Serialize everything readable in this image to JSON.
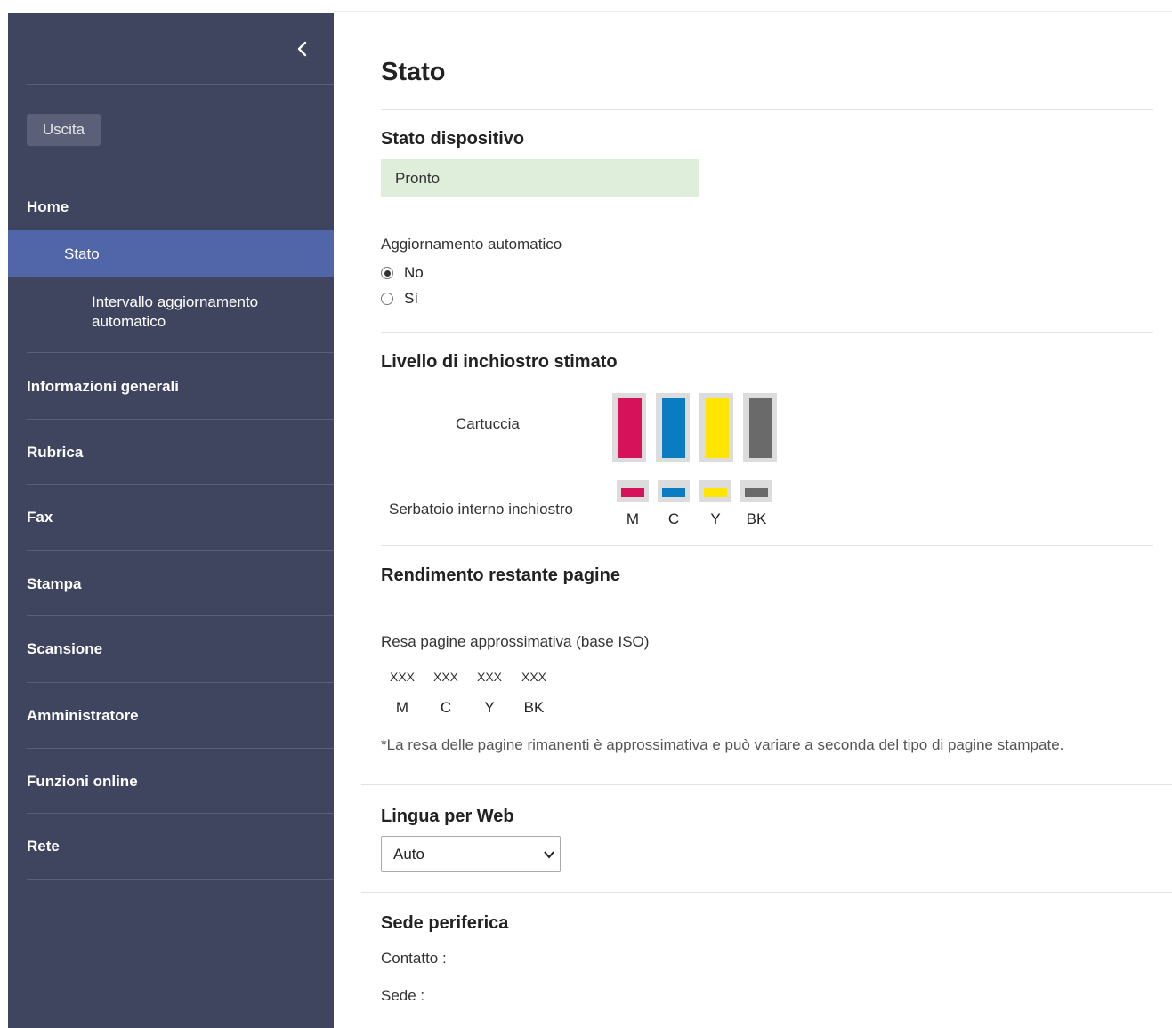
{
  "sidebar": {
    "logout_label": "Uscita",
    "home_label": "Home",
    "status_label": "Stato",
    "auto_refresh_interval_label": "Intervallo aggiornamento automatico",
    "items": [
      {
        "label": "Informazioni generali"
      },
      {
        "label": "Rubrica"
      },
      {
        "label": "Fax"
      },
      {
        "label": "Stampa"
      },
      {
        "label": "Scansione"
      },
      {
        "label": "Amministratore"
      },
      {
        "label": "Funzioni online"
      },
      {
        "label": "Rete"
      }
    ]
  },
  "main": {
    "title": "Stato",
    "device_status": {
      "heading": "Stato dispositivo",
      "value": "Pronto",
      "status_color": "#dfeeda"
    },
    "auto_refresh": {
      "label": "Aggiornamento automatico",
      "options": [
        {
          "label": "No",
          "selected": true
        },
        {
          "label": "Sì",
          "selected": false
        }
      ]
    },
    "ink_level": {
      "heading": "Livello di inchiostro stimato",
      "cartridge_label": "Cartuccia",
      "tank_label": "Serbatoio interno inchiostro",
      "inks": [
        {
          "label": "M",
          "color": "#d6125a"
        },
        {
          "label": "C",
          "color": "#0a7dc2"
        },
        {
          "label": "Y",
          "color": "#ffe500"
        },
        {
          "label": "BK",
          "color": "#6a6a6a"
        }
      ]
    },
    "page_yield": {
      "heading": "Rendimento restante pagine",
      "label": "Resa pagine approssimativa (base ISO)",
      "values": [
        {
          "label": "M",
          "value": "XXX"
        },
        {
          "label": "C",
          "value": "XXX"
        },
        {
          "label": "Y",
          "value": "XXX"
        },
        {
          "label": "BK",
          "value": "XXX"
        }
      ],
      "note": "*La resa delle pagine rimanenti è approssimativa e può variare a seconda del tipo di pagine stampate."
    },
    "web_language": {
      "heading": "Lingua per Web",
      "selected": "Auto"
    },
    "location": {
      "heading": "Sede periferica",
      "contact_label": "Contatto :",
      "location_label": "Sede :"
    }
  },
  "colors": {
    "sidebar_bg": "#3f455f",
    "sidebar_active": "#5066a8"
  },
  "icons": {
    "collapse": "chevron-left-icon",
    "dropdown": "chevron-down-icon"
  }
}
